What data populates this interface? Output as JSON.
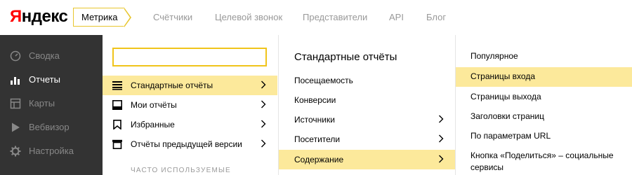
{
  "header": {
    "logo_first": "Я",
    "logo_rest": "ндекс",
    "service": "Метрика",
    "nav": [
      "Счётчики",
      "Целевой звонок",
      "Представители",
      "API",
      "Блог"
    ]
  },
  "sidebar": {
    "items": [
      {
        "label": "Сводка",
        "icon": "dashboard-icon"
      },
      {
        "label": "Отчеты",
        "icon": "bar-chart-icon",
        "active": true
      },
      {
        "label": "Карты",
        "icon": "map-icon"
      },
      {
        "label": "Вебвизор",
        "icon": "play-icon"
      },
      {
        "label": "Настройка",
        "icon": "gear-icon"
      }
    ]
  },
  "reports_menu": {
    "search": {
      "value": "",
      "placeholder": ""
    },
    "items": [
      {
        "label": "Стандартные отчёты",
        "icon": "list-icon",
        "selected": true
      },
      {
        "label": "Мои отчёты",
        "icon": "inbox-icon"
      },
      {
        "label": "Избранные",
        "icon": "bookmark-icon"
      },
      {
        "label": "Отчёты предыдущей версии",
        "icon": "archive-icon"
      }
    ],
    "section_title": "ЧАСТО ИСПОЛЬЗУЕМЫЕ"
  },
  "standard_reports": {
    "title": "Стандартные отчёты",
    "items": [
      {
        "label": "Посещаемость",
        "has_children": false
      },
      {
        "label": "Конверсии",
        "has_children": false
      },
      {
        "label": "Источники",
        "has_children": true
      },
      {
        "label": "Посетители",
        "has_children": true
      },
      {
        "label": "Содержание",
        "has_children": true,
        "selected": true
      }
    ]
  },
  "content_reports": {
    "items": [
      {
        "label": "Популярное"
      },
      {
        "label": "Страницы входа",
        "selected": true
      },
      {
        "label": "Страницы выхода"
      },
      {
        "label": "Заголовки страниц"
      },
      {
        "label": "По параметрам URL"
      },
      {
        "label": "Кнопка «Поделиться» – социальные сервисы"
      }
    ]
  },
  "colors": {
    "accent_yellow": "#fce99b",
    "search_border": "#f0c41b",
    "sidebar_bg": "#333333",
    "logo_red": "#ff0000"
  }
}
